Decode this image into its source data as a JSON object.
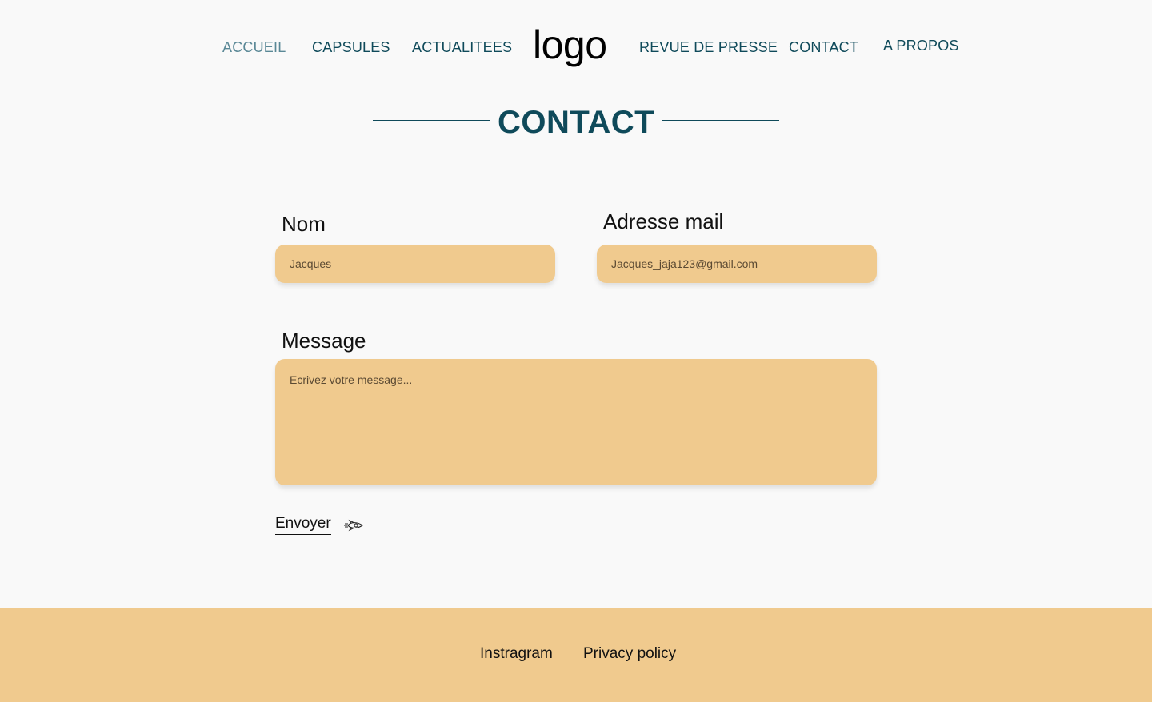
{
  "nav": {
    "items": [
      {
        "label": "ACCUEIL"
      },
      {
        "label": "CAPSULES"
      },
      {
        "label": "ACTUALITEES"
      },
      {
        "label": "REVUE DE PRESSE"
      },
      {
        "label": "CONTACT"
      },
      {
        "label": "A PROPOS"
      }
    ],
    "logo": "logo"
  },
  "page": {
    "title": "CONTACT"
  },
  "form": {
    "name_label": "Nom",
    "name_value": "Jacques",
    "email_label": "Adresse mail",
    "email_value": "Jacques_jaja123@gmail.com",
    "message_label": "Message",
    "message_placeholder": "Ecrivez votre message...",
    "send_label": "Envoyer",
    "send_icon": "rocket-icon"
  },
  "footer": {
    "links": [
      {
        "label": "Instragram"
      },
      {
        "label": "Privacy policy"
      }
    ]
  },
  "colors": {
    "brand": "#0f4a5a",
    "nav_active": "#5a8896",
    "field_bg": "#f0ca8e",
    "page_bg": "#f9f9f9"
  }
}
